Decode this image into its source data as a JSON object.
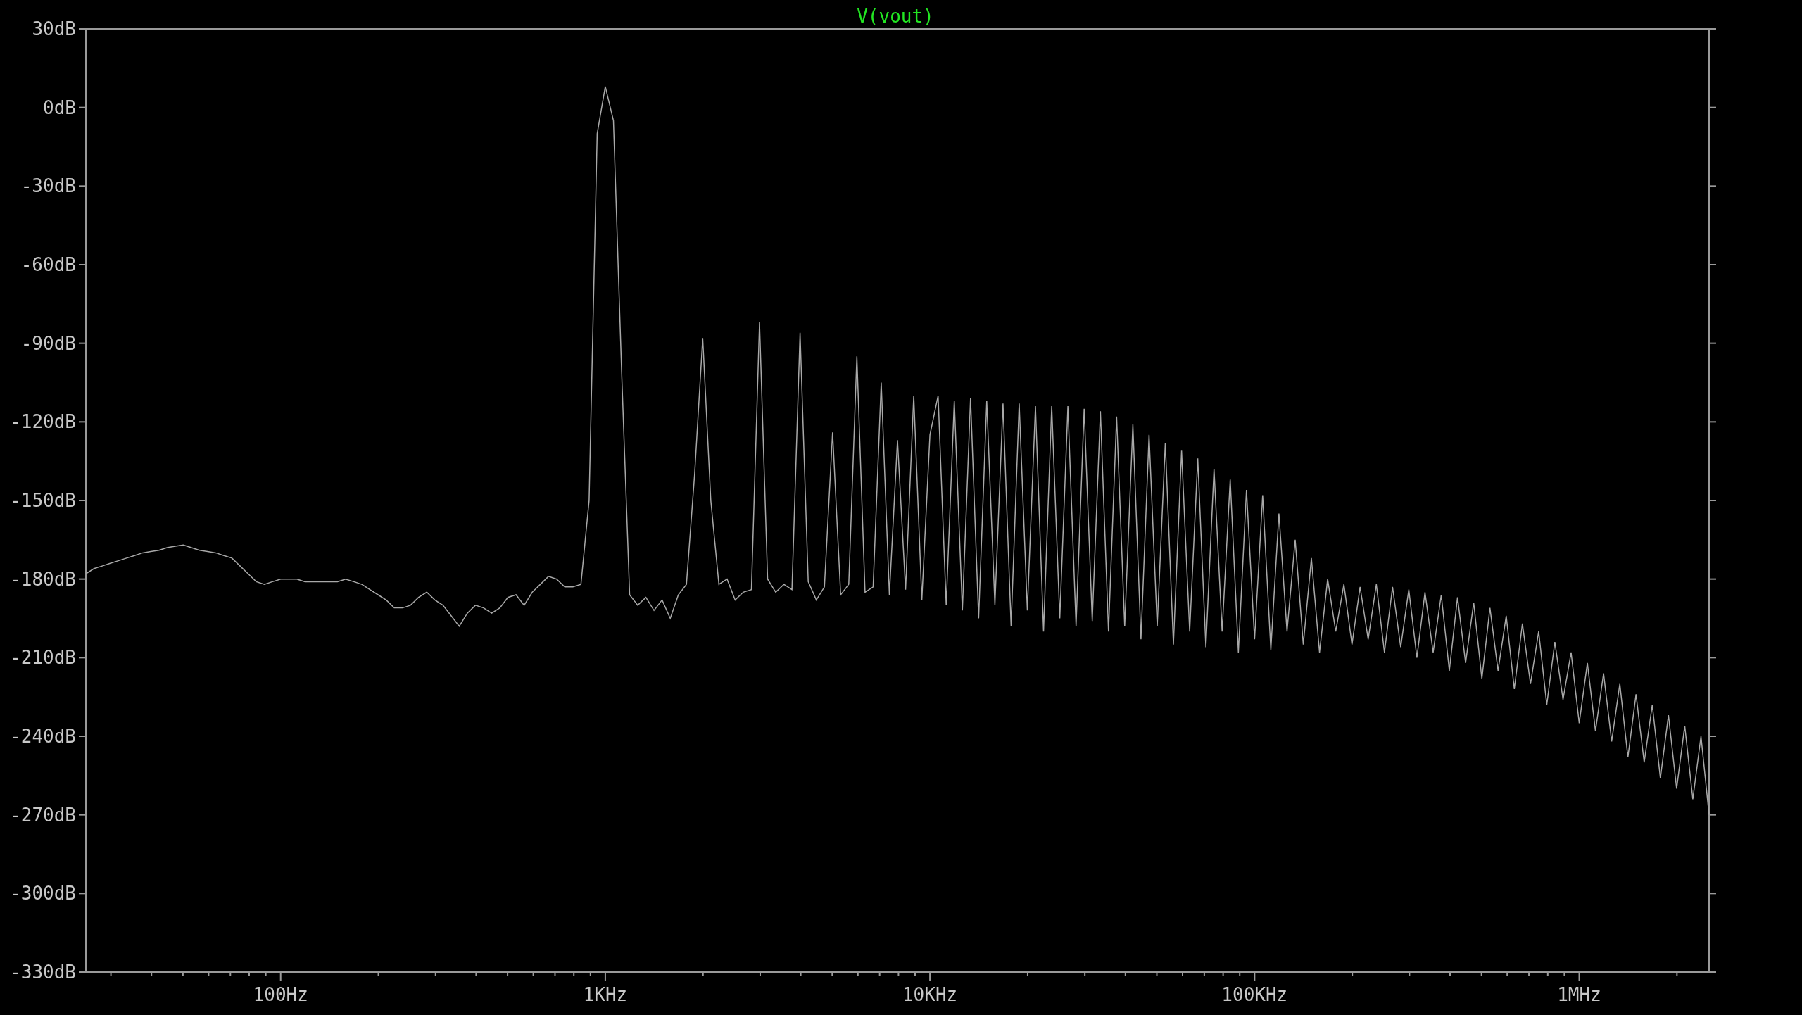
{
  "plot": {
    "chart_data": {
      "type": "line",
      "ylim": [
        -330,
        30
      ],
      "yticks": [
        {
          "value": 30,
          "label": "30dB"
        },
        {
          "value": 0,
          "label": "0dB"
        },
        {
          "value": -30,
          "label": "-30dB"
        },
        {
          "value": -60,
          "label": "-60dB"
        },
        {
          "value": -90,
          "label": "-90dB"
        },
        {
          "value": -120,
          "label": "-120dB"
        },
        {
          "value": -150,
          "label": "-150dB"
        },
        {
          "value": -180,
          "label": "-180dB"
        },
        {
          "value": -210,
          "label": "-210dB"
        },
        {
          "value": -240,
          "label": "-240dB"
        },
        {
          "value": -270,
          "label": "-270dB"
        },
        {
          "value": -300,
          "label": "-300dB"
        },
        {
          "value": -330,
          "label": "-330dB"
        }
      ],
      "categories": [
        null,
        null,
        null,
        null,
        null,
        null,
        null,
        null,
        null,
        null,
        null,
        null,
        null,
        null,
        null,
        null,
        null,
        null,
        null,
        null,
        null,
        null,
        null,
        null,
        "100Hz",
        null,
        null,
        null,
        null,
        null,
        null,
        null,
        null,
        null,
        null,
        null,
        null,
        null,
        null,
        null,
        null,
        null,
        null,
        null,
        null,
        null,
        null,
        null,
        null,
        null,
        null,
        null,
        null,
        null,
        null,
        null,
        null,
        null,
        null,
        null,
        null,
        null,
        null,
        null,
        "1KHz",
        null,
        null,
        null,
        null,
        null,
        null,
        null,
        null,
        null,
        null,
        null,
        null,
        null,
        null,
        null,
        null,
        null,
        null,
        null,
        null,
        null,
        null,
        null,
        null,
        null,
        null,
        null,
        null,
        null,
        null,
        null,
        null,
        null,
        null,
        null,
        null,
        null,
        null,
        null,
        "10KHz",
        null,
        null,
        null,
        null,
        null,
        null,
        null,
        null,
        null,
        null,
        null,
        null,
        null,
        null,
        null,
        null,
        null,
        null,
        null,
        null,
        null,
        null,
        null,
        null,
        null,
        null,
        null,
        null,
        null,
        null,
        null,
        null,
        null,
        null,
        null,
        null,
        null,
        null,
        null,
        "100KHz",
        null,
        null,
        null,
        null,
        null,
        null,
        null,
        null,
        null,
        null,
        null,
        null,
        null,
        null,
        null,
        null,
        null,
        null,
        null,
        null,
        null,
        null,
        null,
        null,
        null,
        null,
        null,
        null,
        null,
        null,
        null,
        null,
        null,
        null,
        null,
        null,
        null,
        null,
        null,
        "1MHz",
        null,
        null,
        null,
        null,
        null,
        null,
        null,
        null,
        null,
        null,
        null,
        null,
        null,
        null,
        null,
        null
      ],
      "series": [
        {
          "name": "V(vout)",
          "color": "#a8a8a8",
          "values": [
            -178,
            -176,
            -175,
            -174,
            -173,
            -172,
            -171,
            -170,
            -169.5,
            -169,
            -168,
            -167.5,
            -167,
            -168,
            -169,
            -169.5,
            -170,
            -171,
            -172,
            -175,
            -178,
            -181,
            -182,
            -181,
            -180,
            -180,
            -180,
            -181,
            -181,
            -181,
            -181,
            -181,
            -180,
            -181,
            -182,
            -184,
            -186,
            -188,
            -191,
            -191,
            -190,
            -187,
            -185,
            -188,
            -190,
            -194,
            -198,
            -193,
            -190,
            -191,
            -193,
            -191,
            -187,
            -186,
            -190,
            -185,
            -182,
            -179,
            -180,
            -183,
            -183,
            -182,
            -150,
            -10,
            8,
            -5,
            -100,
            -186,
            -190,
            -187,
            -192,
            -188,
            -195,
            -186,
            -182,
            -140,
            -88,
            -150,
            -182,
            -180,
            -188,
            -185,
            -184,
            -82,
            -180,
            -185,
            -182,
            -184,
            -86,
            -181,
            -188,
            -183,
            -124,
            -186,
            -182,
            -95,
            -185,
            -183,
            -105,
            -186,
            -127,
            -184,
            -110,
            -188,
            -125,
            -110,
            -190,
            -112,
            -192,
            -111,
            -195,
            -112,
            -190,
            -113,
            -198,
            -113,
            -192,
            -114,
            -200,
            -114,
            -195,
            -114,
            -198,
            -115,
            -196,
            -116,
            -200,
            -118,
            -198,
            -121,
            -203,
            -125,
            -198,
            -128,
            -205,
            -131,
            -200,
            -134,
            -206,
            -138,
            -200,
            -142,
            -208,
            -146,
            -203,
            -148,
            -207,
            -155,
            -200,
            -165,
            -205,
            -172,
            -208,
            -180,
            -200,
            -182,
            -205,
            -183,
            -203,
            -182,
            -208,
            -183,
            -206,
            -184,
            -210,
            -185,
            -208,
            -186,
            -215,
            -187,
            -212,
            -189,
            -218,
            -191,
            -215,
            -194,
            -222,
            -197,
            -220,
            -200,
            -228,
            -204,
            -226,
            -208,
            -235,
            -212,
            -238,
            -216,
            -242,
            -220,
            -248,
            -224,
            -250,
            -228,
            -256,
            -232,
            -260,
            -236,
            -264,
            -240,
            -270
          ]
        }
      ]
    }
  }
}
